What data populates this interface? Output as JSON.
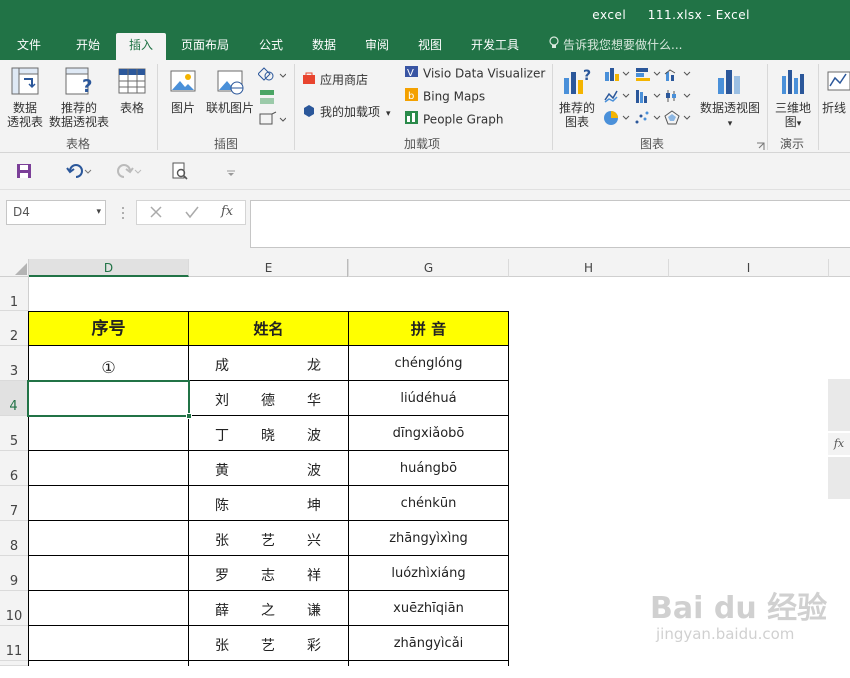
{
  "titlebar": {
    "title": "excel     111.xlsx - Excel"
  },
  "tabs": [
    "文件",
    "开始",
    "插入",
    "页面布局",
    "公式",
    "数据",
    "审阅",
    "视图",
    "开发工具"
  ],
  "active_tab": "插入",
  "tellme": "告诉我您想要做什么...",
  "ribbon": {
    "pivot_label1": "数据",
    "pivot_label2": "透视表",
    "rec_pivot_label1": "推荐的",
    "rec_pivot_label2": "数据透视表",
    "table_label": "表格",
    "group_tables": "表格",
    "pictures_label": "图片",
    "online_pictures_label": "联机图片",
    "group_illustrations": "插图",
    "store_label": "应用商店",
    "my_addins_label": "我的加载项",
    "visio_label": "Visio Data Visualizer",
    "bing_label": "Bing Maps",
    "people_label": "People Graph",
    "group_addins": "加载项",
    "rec_charts_label1": "推荐的",
    "rec_charts_label2": "图表",
    "pivot_chart_label": "数据透视图",
    "group_charts": "图表",
    "map3d_label1": "三维地",
    "map3d_label2": "图",
    "group_tours": "演示",
    "sparkline_label": "折线"
  },
  "formula_bar": {
    "name_box": "D4",
    "fx": "fx"
  },
  "columns": [
    "D",
    "E",
    "G",
    "H",
    "I"
  ],
  "rows": [
    "1",
    "2",
    "3",
    "4",
    "5",
    "6",
    "7",
    "8",
    "9",
    "10",
    "11"
  ],
  "sheet": {
    "header_seq": "序号",
    "header_name": "姓名",
    "header_pinyin": "拼 音",
    "d3_value": "①",
    "people": [
      {
        "c1": "成",
        "c2": "",
        "c3": "龙",
        "pinyin": "chénglóng"
      },
      {
        "c1": "刘",
        "c2": "德",
        "c3": "华",
        "pinyin": "liúdéhuá"
      },
      {
        "c1": "丁",
        "c2": "晓",
        "c3": "波",
        "pinyin": "dīngxiǎobō"
      },
      {
        "c1": "黄",
        "c2": "",
        "c3": "波",
        "pinyin": "huángbō"
      },
      {
        "c1": "陈",
        "c2": "",
        "c3": "坤",
        "pinyin": "chénkūn"
      },
      {
        "c1": "张",
        "c2": "艺",
        "c3": "兴",
        "pinyin": "zhāngyìxìng"
      },
      {
        "c1": "罗",
        "c2": "志",
        "c3": "祥",
        "pinyin": "luózhìxiáng"
      },
      {
        "c1": "薛",
        "c2": "之",
        "c3": "谦",
        "pinyin": "xuēzhīqiān"
      },
      {
        "c1": "张",
        "c2": "艺",
        "c3": "彩",
        "pinyin": "zhāngyìcǎi"
      }
    ]
  },
  "side_panel": {
    "fx": "fx"
  },
  "watermark": {
    "logo": "Bai du 经验",
    "url": "jingyan.baidu.com"
  },
  "colors": {
    "excel_green": "#217346",
    "header_fill": "#ffff00"
  }
}
